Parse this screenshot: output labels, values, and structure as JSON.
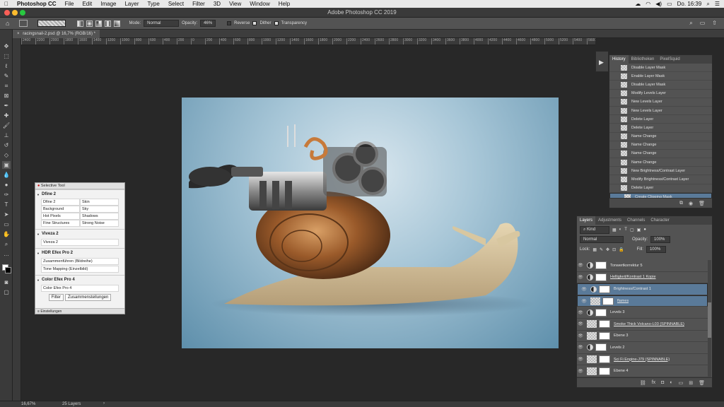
{
  "menubar": {
    "app": "Photoshop CC",
    "items": [
      "File",
      "Edit",
      "Image",
      "Layer",
      "Type",
      "Select",
      "Filter",
      "3D",
      "View",
      "Window",
      "Help"
    ],
    "clock": "Do. 16:39"
  },
  "window": {
    "title": "Adobe Photoshop CC 2019"
  },
  "options": {
    "mode_label": "Mode:",
    "mode_value": "Normal",
    "opacity_label": "Opacity:",
    "opacity_value": "46%",
    "reverse": "Reverse",
    "dither": "Dither",
    "transparency": "Transparency"
  },
  "document": {
    "tab": "racingsnail-2.psd @ 16,7% (RGB/16) *"
  },
  "ruler": [
    "2400",
    "2200",
    "2000",
    "1800",
    "1600",
    "1400",
    "1200",
    "1000",
    "800",
    "600",
    "400",
    "200",
    "0",
    "200",
    "400",
    "600",
    "800",
    "1000",
    "1200",
    "1400",
    "1600",
    "1800",
    "2000",
    "2200",
    "2400",
    "2600",
    "2800",
    "3000",
    "3200",
    "3400",
    "3600",
    "3800",
    "4000",
    "4200",
    "4400",
    "4600",
    "4800",
    "5000",
    "5200",
    "5400",
    "5600"
  ],
  "status": {
    "zoom": "16,67%",
    "layers": "25 Layers"
  },
  "history": {
    "tabs": [
      "History",
      "Bibliotheken",
      "PixelSquid"
    ],
    "items": [
      "Disable Layer Mask",
      "Enable Layer Mask",
      "Disable Layer Mask",
      "Modify Levels Layer",
      "New Levels Layer",
      "New Levels Layer",
      "Delete Layer",
      "Delete Layer",
      "Name Change",
      "Name Change",
      "Name Change",
      "Name Change",
      "New Brightness/Contrast Layer",
      "Modify Brightness/Contrast Layer",
      "Delete Layer",
      "Create Clipping Mask"
    ]
  },
  "layers": {
    "tabs": [
      "Layers",
      "Adjustments",
      "Channels",
      "Character"
    ],
    "kind": "Kind",
    "blend": "Normal",
    "opacity_label": "Opacity:",
    "opacity_value": "100%",
    "lock_label": "Lock:",
    "fill_label": "Fill:",
    "fill_value": "100%",
    "items": [
      "Tonwertkorrektur 5",
      "Helligkeit/Kontrast 1 Kopie",
      "Brightness/Contrast 1",
      "flames",
      "Levels 3",
      "Smoke Thick Volcano-L03 (SPINNABLE)",
      "Ebene 3",
      "Levels 2",
      "Sci Fi Engine-J79 (SPINNABLE)",
      "Ebene 4"
    ]
  },
  "selective_tool": {
    "title": "Selective Tool",
    "dfine": {
      "heading": "Dfine 2",
      "cells": [
        "Dfine 2",
        "Skin",
        "Background",
        "Sky",
        "Hot Pixels",
        "Shadows",
        "Fine Structures",
        "Strong Noise"
      ]
    },
    "viveza": {
      "heading": "Viveza 2",
      "item": "Viveza 2"
    },
    "hdr": {
      "heading": "HDR Efex Pro 2",
      "items": [
        "Zusammenführen (Bildreihe)",
        "Tone Mapping (Einzelbild)"
      ]
    },
    "color": {
      "heading": "Color Efex Pro 4",
      "item": "Color Efex Pro 4"
    },
    "buttons": [
      "Filter",
      "Zusammenstellungen"
    ],
    "footer": "Einstellungen"
  }
}
